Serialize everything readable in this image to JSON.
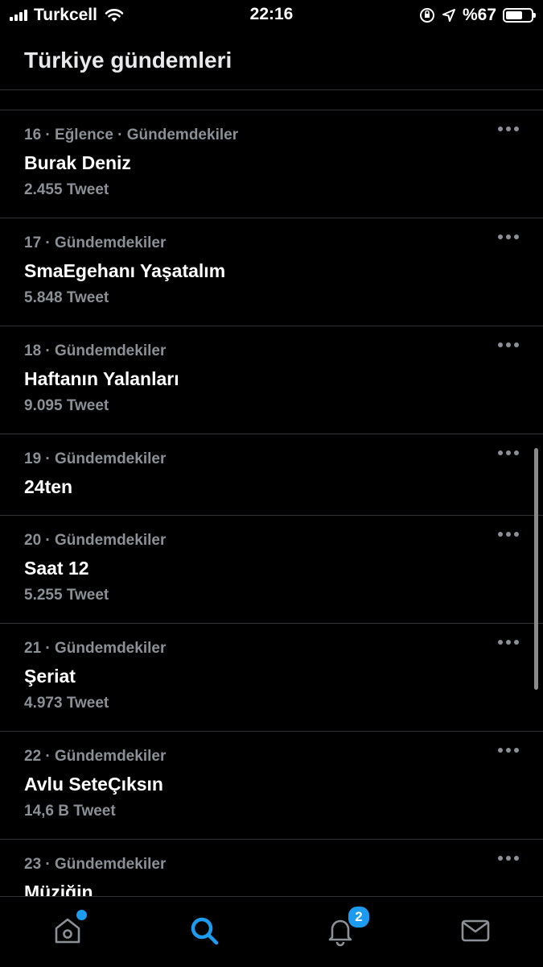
{
  "status_bar": {
    "carrier": "Turkcell",
    "time": "22:16",
    "battery": "%67",
    "battery_level": 0.67
  },
  "header": {
    "title": "Türkiye gündemleri"
  },
  "trends": [
    {
      "meta": "16 · Eğlence · Gündemdekiler",
      "title": "Burak Deniz",
      "count": "2.455 Tweet"
    },
    {
      "meta": "17 · Gündemdekiler",
      "title": "SmaEgehanı Yaşatalım",
      "count": "5.848 Tweet"
    },
    {
      "meta": "18 · Gündemdekiler",
      "title": "Haftanın Yalanları",
      "count": "9.095 Tweet"
    },
    {
      "meta": "19 · Gündemdekiler",
      "title": "24ten",
      "count": ""
    },
    {
      "meta": "20 · Gündemdekiler",
      "title": "Saat 12",
      "count": "5.255 Tweet"
    },
    {
      "meta": "21 · Gündemdekiler",
      "title": "Şeriat",
      "count": "4.973 Tweet"
    },
    {
      "meta": "22 · Gündemdekiler",
      "title": "Avlu SeteÇıksın",
      "count": "14,6 B Tweet"
    },
    {
      "meta": "23 · Gündemdekiler",
      "title": "Müziğin",
      "count": ""
    }
  ],
  "tabbar": {
    "notifications_badge": "2",
    "colors": {
      "active": "#1d9bf0",
      "inactive": "#8b9097"
    },
    "icons": [
      "home-icon",
      "search-icon",
      "bell-icon",
      "mail-icon"
    ]
  }
}
